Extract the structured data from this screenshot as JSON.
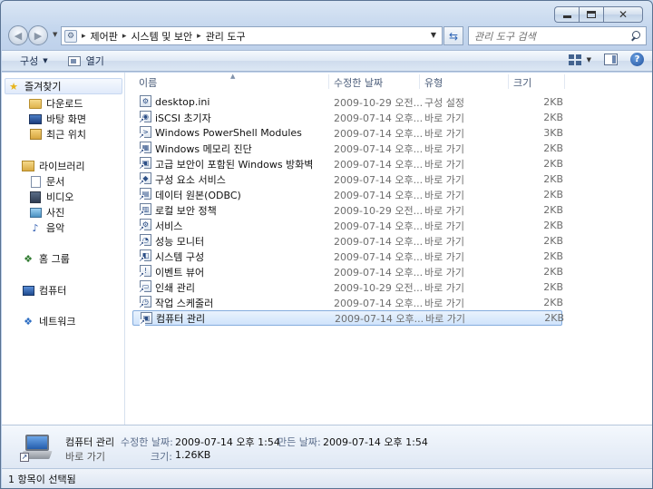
{
  "search": {
    "placeholder": "관리 도구 검색"
  },
  "address": {
    "crumbs": [
      "제어판",
      "시스템 및 보안",
      "관리 도구"
    ]
  },
  "toolbar": {
    "organize": "구성",
    "open": "열기"
  },
  "navpane": {
    "favorites": "즐겨찾기",
    "fav_items": [
      "다운로드",
      "바탕 화면",
      "최근 위치"
    ],
    "libraries": "라이브러리",
    "lib_items": [
      "문서",
      "비디오",
      "사진",
      "음악"
    ],
    "homegroup": "홈 그룹",
    "computer": "컴퓨터",
    "network": "네트워크"
  },
  "columns": {
    "name": "이름",
    "date": "수정한 날짜",
    "type": "유형",
    "size": "크기"
  },
  "files": [
    {
      "name": "desktop.ini",
      "date": "2009-10-29 오전...",
      "type": "구성 설정",
      "size": "2KB"
    },
    {
      "name": "iSCSI 초기자",
      "date": "2009-07-14 오후...",
      "type": "바로 가기",
      "size": "2KB"
    },
    {
      "name": "Windows PowerShell Modules",
      "date": "2009-07-14 오후...",
      "type": "바로 가기",
      "size": "3KB"
    },
    {
      "name": "Windows 메모리 진단",
      "date": "2009-07-14 오후...",
      "type": "바로 가기",
      "size": "2KB"
    },
    {
      "name": "고급 보안이 포함된 Windows 방화벽",
      "date": "2009-07-14 오후...",
      "type": "바로 가기",
      "size": "2KB"
    },
    {
      "name": "구성 요소 서비스",
      "date": "2009-07-14 오후...",
      "type": "바로 가기",
      "size": "2KB"
    },
    {
      "name": "데이터 원본(ODBC)",
      "date": "2009-07-14 오후...",
      "type": "바로 가기",
      "size": "2KB"
    },
    {
      "name": "로컬 보안 정책",
      "date": "2009-10-29 오전...",
      "type": "바로 가기",
      "size": "2KB"
    },
    {
      "name": "서비스",
      "date": "2009-07-14 오후...",
      "type": "바로 가기",
      "size": "2KB"
    },
    {
      "name": "성능 모니터",
      "date": "2009-07-14 오후...",
      "type": "바로 가기",
      "size": "2KB"
    },
    {
      "name": "시스템 구성",
      "date": "2009-07-14 오후...",
      "type": "바로 가기",
      "size": "2KB"
    },
    {
      "name": "이벤트 뷰어",
      "date": "2009-07-14 오후...",
      "type": "바로 가기",
      "size": "2KB"
    },
    {
      "name": "인쇄 관리",
      "date": "2009-10-29 오전...",
      "type": "바로 가기",
      "size": "2KB"
    },
    {
      "name": "작업 스케줄러",
      "date": "2009-07-14 오후...",
      "type": "바로 가기",
      "size": "2KB"
    },
    {
      "name": "컴퓨터 관리",
      "date": "2009-07-14 오후...",
      "type": "바로 가기",
      "size": "2KB"
    }
  ],
  "details": {
    "name": "컴퓨터 관리",
    "type": "바로 가기",
    "modified_label": "수정한 날짜:",
    "modified_value": "2009-07-14 오후 1:54",
    "created_label": "만든 날짜:",
    "created_value": "2009-07-14 오후 1:54",
    "size_label": "크기:",
    "size_value": "1.26KB"
  },
  "status": {
    "text": "1 항목이 선택됨"
  }
}
